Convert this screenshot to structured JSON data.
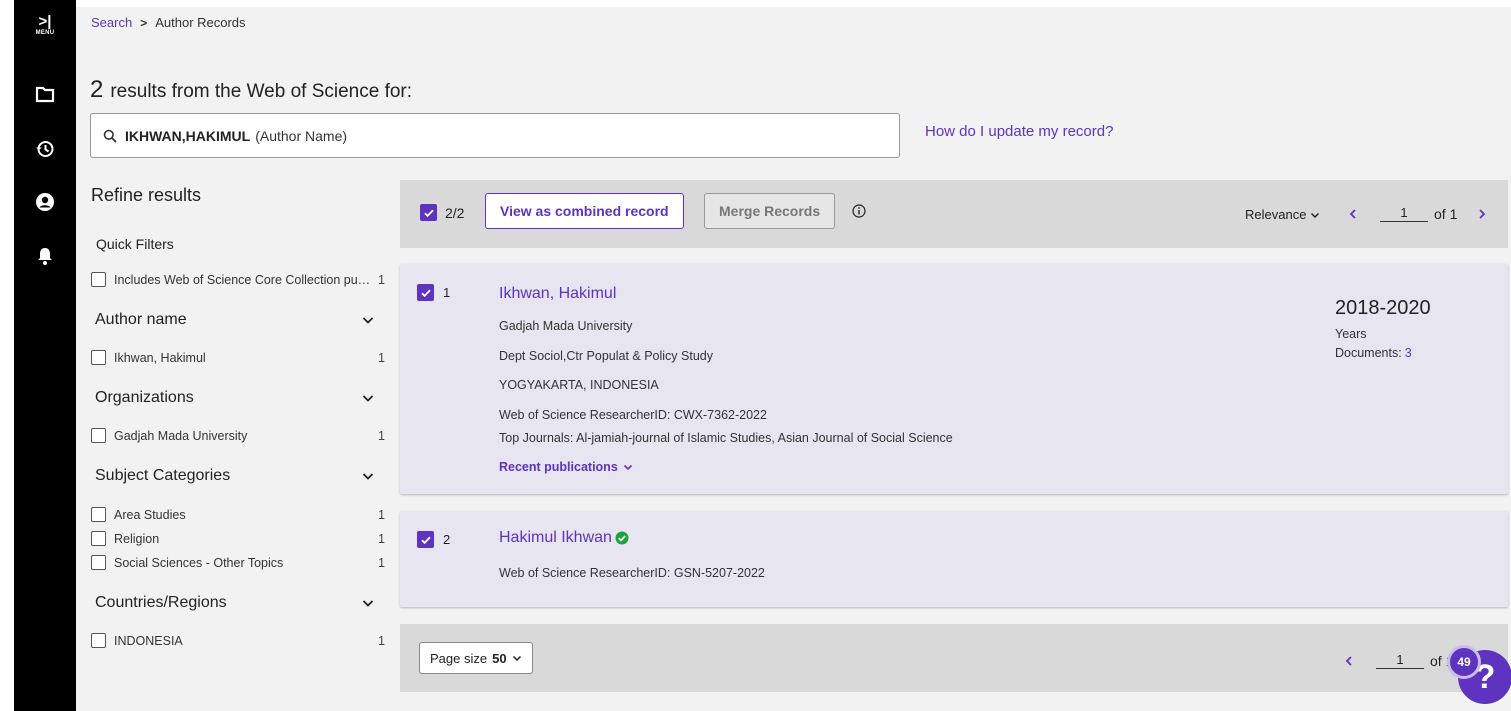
{
  "nav": {
    "menu_label": "MENU"
  },
  "breadcrumb": {
    "search": "Search",
    "current": "Author Records"
  },
  "results": {
    "count": "2",
    "text": "results from the Web of Science for:"
  },
  "search": {
    "term": "IKHWAN,HAKIMUL",
    "field": "(Author Name)"
  },
  "help_link": "How do I update my record?",
  "refine": {
    "title": "Refine results",
    "quick_filters": {
      "title": "Quick Filters",
      "items": [
        {
          "label": "Includes Web of Science Core Collection publications",
          "count": "1"
        }
      ]
    },
    "groups": [
      {
        "title": "Author name",
        "items": [
          {
            "label": "Ikhwan, Hakimul",
            "count": "1"
          }
        ]
      },
      {
        "title": "Organizations",
        "items": [
          {
            "label": "Gadjah Mada University",
            "count": "1"
          }
        ]
      },
      {
        "title": "Subject Categories",
        "items": [
          {
            "label": "Area Studies",
            "count": "1"
          },
          {
            "label": "Religion",
            "count": "1"
          },
          {
            "label": "Social Sciences - Other Topics",
            "count": "1"
          }
        ]
      },
      {
        "title": "Countries/Regions",
        "items": [
          {
            "label": "INDONESIA",
            "count": "1"
          }
        ]
      }
    ]
  },
  "toolbar": {
    "selected": "2/2",
    "view_combined": "View as combined record",
    "merge": "Merge Records",
    "sort": "Relevance",
    "page": "1",
    "of_pages": "of 1"
  },
  "records": [
    {
      "index": "1",
      "name": "Ikhwan, Hakimul",
      "org": "Gadjah Mada University",
      "dept": "Dept Sociol,Ctr Populat & Policy Study",
      "location": "YOGYAKARTA, INDONESIA",
      "researcher_id": "Web of Science ResearcherID: CWX-7362-2022",
      "top_journals": "Top Journals: Al-jamiah-journal of Islamic Studies, Asian Journal of Social Science",
      "recent": "Recent publications",
      "years": "2018-2020",
      "years_label": "Years",
      "docs_label": "Documents:",
      "docs_count": "3"
    },
    {
      "index": "2",
      "name": "Hakimul Ikhwan",
      "researcher_id": "Web of Science ResearcherID: GSN-5207-2022"
    }
  ],
  "bottom": {
    "page_size_label": "Page size",
    "page_size_value": "50",
    "page": "1",
    "of_pages": "of 1"
  },
  "help_badge": "49",
  "help_fab": "?",
  "colors": {
    "accent": "#5e33bf",
    "verified": "#1aa33a",
    "rail": "#000000"
  }
}
